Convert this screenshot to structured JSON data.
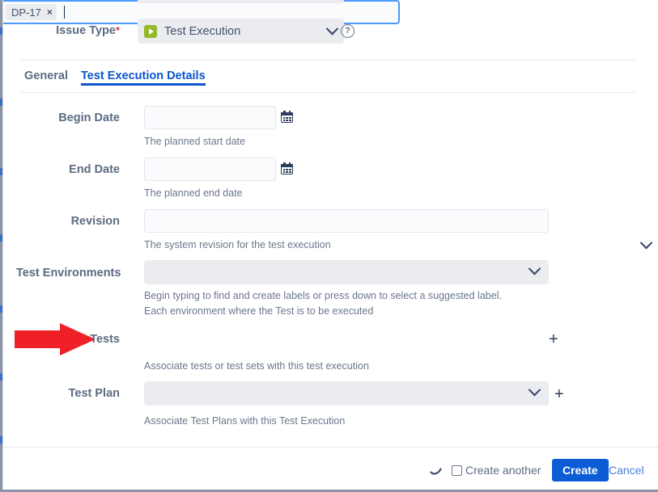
{
  "issue_type": {
    "label": "Issue Type",
    "required_marker": "*",
    "value": "Test Execution",
    "icon": "test-execution-play-icon",
    "icon_color": "#94b82c",
    "help_icon": "?"
  },
  "tabs": [
    {
      "label": "General",
      "active": false
    },
    {
      "label": "Test Execution Details",
      "active": true
    }
  ],
  "fields": [
    {
      "key": "begin_date",
      "label": "Begin Date",
      "value": "",
      "hint": "The planned start date",
      "trailing_icon": "calendar-icon"
    },
    {
      "key": "end_date",
      "label": "End Date",
      "value": "",
      "hint": "The planned end date",
      "trailing_icon": "calendar-icon"
    },
    {
      "key": "revision",
      "label": "Revision",
      "value": "",
      "hint": "The system revision for the test execution"
    },
    {
      "key": "test_environments",
      "label": "Test Environments",
      "value": "",
      "hint": "Begin typing to find and create labels or press down to select a suggested label.",
      "hint2": "Each environment where the Test is to be executed",
      "trailing_icon": "chevron-down-icon"
    },
    {
      "key": "tests",
      "label": "Tests",
      "value": "",
      "chips": [
        {
          "text": "DP-17",
          "remove": "×"
        }
      ],
      "hint": "Associate tests or test sets with this test execution",
      "trailing_icon": "chevron-down-icon",
      "add_button": "+",
      "focused": true
    },
    {
      "key": "test_plan",
      "label": "Test Plan",
      "value": "",
      "hint": "Associate Test Plans with this Test Execution",
      "trailing_icon": "chevron-down-icon",
      "add_button": "+"
    }
  ],
  "annotation": {
    "type": "red-arrow",
    "points_at": "Tests",
    "color": "#ef2027"
  },
  "footer": {
    "spinner": "loading-spinner-icon",
    "create_another_label": "Create another",
    "create_another_checked": false,
    "create_label": "Create",
    "cancel_label": "Cancel",
    "create_color": "#0b5cd5",
    "cancel_color": "#4a7fd1"
  }
}
